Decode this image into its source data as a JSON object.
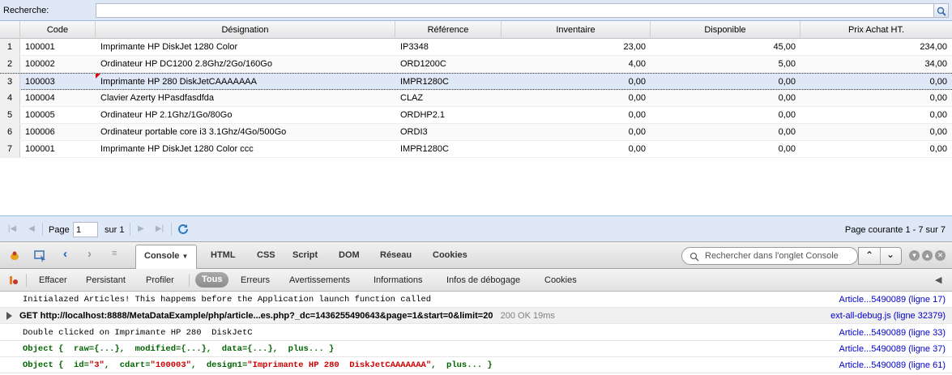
{
  "search": {
    "label": "Recherche:",
    "value": "",
    "placeholder": ""
  },
  "grid": {
    "columns": [
      "Code",
      "Désignation",
      "Référence",
      "Inventaire",
      "Disponible",
      "Prix Achat HT."
    ],
    "rows": [
      {
        "n": "1",
        "code": "100001",
        "designation": "Imprimante HP DiskJet 1280 Color",
        "reference": "IP3348",
        "inventaire": "23,00",
        "disponible": "45,00",
        "prix": "234,00"
      },
      {
        "n": "2",
        "code": "100002",
        "designation": "Ordinateur HP DC1200 2.8Ghz/2Go/160Go",
        "reference": "ORD1200C",
        "inventaire": "4,00",
        "disponible": "5,00",
        "prix": "34,00"
      },
      {
        "n": "3",
        "code": "100003",
        "designation": "Imprimante HP 280 DiskJetCAAAAAAA",
        "reference": "IMPR1280C",
        "inventaire": "0,00",
        "disponible": "0,00",
        "prix": "0,00"
      },
      {
        "n": "4",
        "code": "100004",
        "designation": "Clavier Azerty HPasdfasdfda",
        "reference": "CLAZ",
        "inventaire": "0,00",
        "disponible": "0,00",
        "prix": "0,00"
      },
      {
        "n": "5",
        "code": "100005",
        "designation": "Ordinateur HP 2.1Ghz/1Go/80Go",
        "reference": "ORDHP2.1",
        "inventaire": "0,00",
        "disponible": "0,00",
        "prix": "0,00"
      },
      {
        "n": "6",
        "code": "100006",
        "designation": "Ordinateur portable core i3 3.1Ghz/4Go/500Go",
        "reference": "ORDI3",
        "inventaire": "0,00",
        "disponible": "0,00",
        "prix": "0,00"
      },
      {
        "n": "7",
        "code": "100001",
        "designation": "Imprimante HP DiskJet 1280 Color ccc",
        "reference": "IMPR1280C",
        "inventaire": "0,00",
        "disponible": "0,00",
        "prix": "0,00"
      }
    ],
    "selected_row": "3"
  },
  "paging": {
    "page_label": "Page",
    "page_value": "1",
    "of_label": "sur 1",
    "status": "Page courante 1 - 7 sur 7"
  },
  "firebug": {
    "tabs": [
      "Console",
      "HTML",
      "CSS",
      "Script",
      "DOM",
      "Réseau",
      "Cookies"
    ],
    "active_tab": "Console",
    "search_placeholder": "Rechercher dans l'onglet Console",
    "filters": [
      "Effacer",
      "Persistant",
      "Profiler",
      "Tous",
      "Erreurs",
      "Avertissements",
      "Informations",
      "Infos de débogage",
      "Cookies"
    ],
    "active_filter": "Tous",
    "logs": [
      {
        "text": "Initialazed Articles! This happems before the Application launch function called",
        "source": "Article...5490089 (ligne 17)"
      },
      {
        "text": "GET http://localhost:8888/MetaDataExample/php/article...es.php?_dc=1436255490643&page=1&start=0&limit=20",
        "status": "200 OK 19ms",
        "source": "ext-all-debug.js (ligne 32379)"
      },
      {
        "text": "Double clicked on Imprimante HP 280  DiskJetC",
        "source": "Article...5490089 (ligne 33)"
      },
      {
        "text": "Object {  raw={...},  modified={...},  data={...},  plus... }",
        "source": "Article...5490089 (ligne 37)"
      },
      {
        "obj_prefix": "Object {  id=",
        "id": "\"3\"",
        "cdart_label": ",  cdart=",
        "cdart": "\"100003\"",
        "design_label": ",  design1=",
        "design": "\"Imprimante HP 280  DiskJetCAAAAAAA\"",
        "suffix": ",  plus... }",
        "source": "Article...5490089 (ligne 61)"
      }
    ]
  }
}
